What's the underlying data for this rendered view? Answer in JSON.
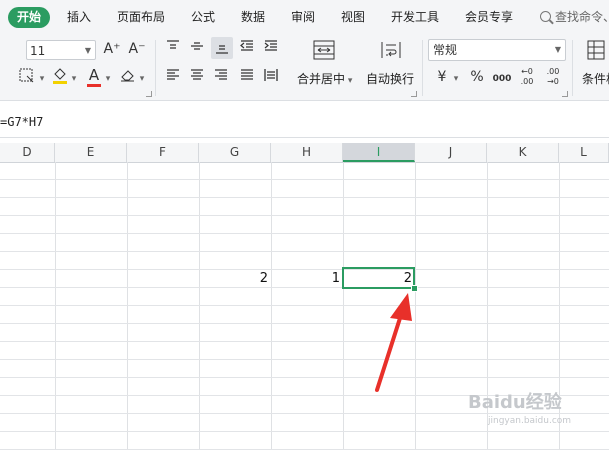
{
  "menu": {
    "tabs": [
      "开始",
      "插入",
      "页面布局",
      "公式",
      "数据",
      "审阅",
      "视图",
      "开发工具",
      "会员专享"
    ],
    "search_label": "查找命令、"
  },
  "ribbon": {
    "font_size": "11",
    "grow_font": "A⁺",
    "shrink_font": "A⁻",
    "merge_label": "合并居中",
    "wrap_label": "自动换行",
    "number_format": "常规",
    "currency_symbol": "¥",
    "percent_symbol": "%",
    "thousands_symbol": "000",
    "increase_decimal": "←0 .00",
    "decrease_decimal": ".00 →0",
    "conditional_label": "条件格",
    "font_color_letter": "A"
  },
  "formula_bar": {
    "formula": "=G7*H7"
  },
  "sheet": {
    "columns": [
      "D",
      "E",
      "F",
      "G",
      "H",
      "I",
      "J",
      "K",
      "L"
    ],
    "selected_column": "I",
    "row7": {
      "G": "2",
      "H": "1",
      "I": "2"
    }
  },
  "colors": {
    "accent": "#2b9c61",
    "arrow": "#e8302a"
  },
  "watermark": {
    "main": "Baidu经验",
    "sub": "jingyan.baidu.com"
  }
}
